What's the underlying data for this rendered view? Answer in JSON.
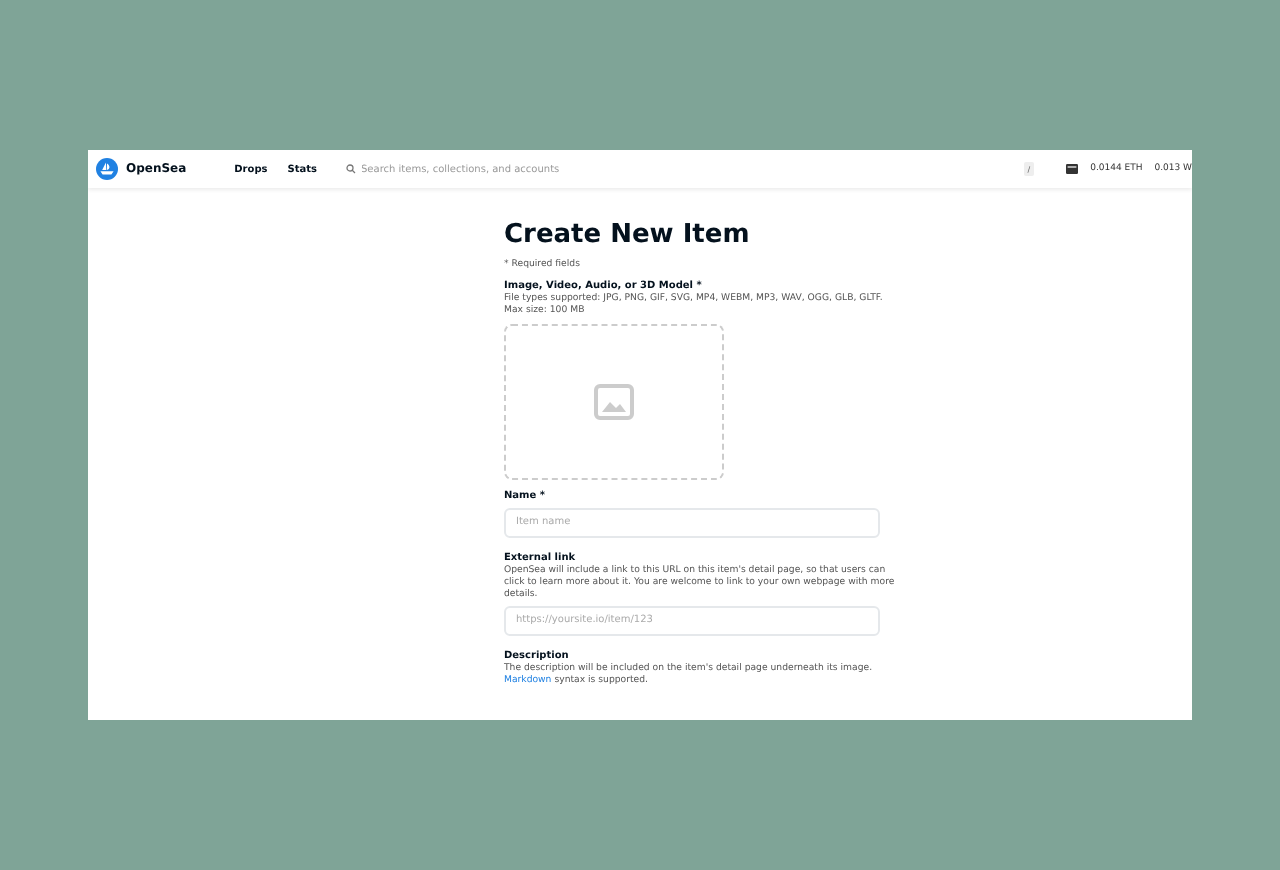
{
  "header": {
    "logo": "OpenSea",
    "nav": [
      "Drops",
      "Stats"
    ],
    "search": {
      "placeholder": "Search items, collections, and accounts",
      "shortcut": "/"
    },
    "balances": [
      "0.0144 ETH",
      "0.013 W"
    ]
  },
  "form": {
    "title": "Create New Item",
    "required_note": "* Required fields",
    "media": {
      "label": "Image, Video, Audio, or 3D Model *",
      "hint": "File types supported: JPG, PNG, GIF, SVG, MP4, WEBM, MP3, WAV, OGG, GLB, GLTF. Max size: 100 MB"
    },
    "fields": [
      {
        "label": "Name *",
        "placeholder": "Item name"
      },
      {
        "label": "External link",
        "hint": "OpenSea will include a link to this URL on this item's detail page, so that users can click to learn more about it. You are welcome to link to your own webpage with more details.",
        "placeholder": "https://yoursite.io/item/123"
      },
      {
        "label": "Description",
        "hint": "The description will be included on the item's detail page underneath its image.",
        "link": "Markdown",
        "hint_end": "syntax is supported."
      }
    ]
  }
}
